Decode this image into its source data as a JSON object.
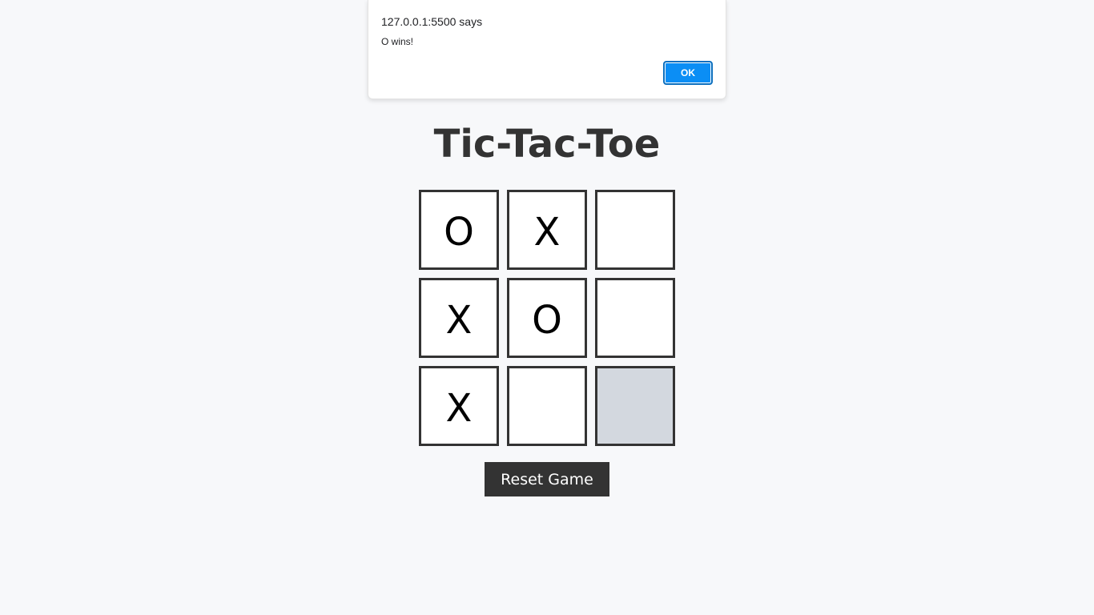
{
  "alert": {
    "origin": "127.0.0.1:5500 says",
    "message": "O wins!",
    "ok_label": "OK"
  },
  "game": {
    "title": "Tic-Tac-Toe",
    "board": [
      "O",
      "X",
      "",
      "X",
      "O",
      "",
      "X",
      "",
      ""
    ],
    "reset_label": "Reset Game"
  },
  "colors": {
    "background": "#f7f8fa",
    "cell_border": "#333333",
    "hover_cell": "#d3d8df",
    "ok_button": "#0b8ef5",
    "reset_button": "#333333"
  }
}
